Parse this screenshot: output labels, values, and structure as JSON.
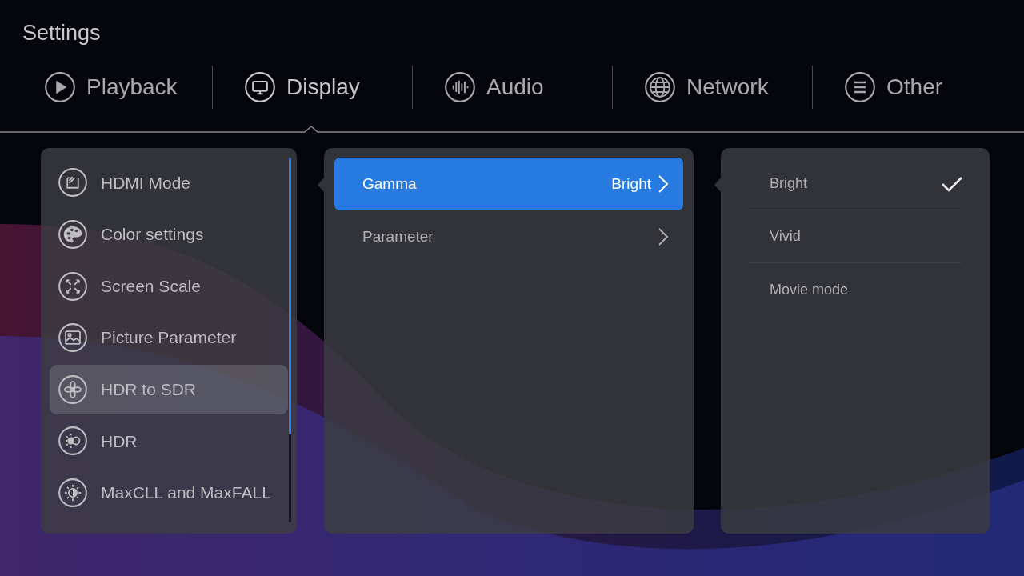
{
  "title": "Settings",
  "tabs": [
    {
      "label": "Playback",
      "selected": false
    },
    {
      "label": "Display",
      "selected": true
    },
    {
      "label": "Audio",
      "selected": false
    },
    {
      "label": "Network",
      "selected": false
    },
    {
      "label": "Other",
      "selected": false
    }
  ],
  "sidebar": {
    "items": [
      {
        "label": "HDMI Mode",
        "selected": false
      },
      {
        "label": "Color settings",
        "selected": false
      },
      {
        "label": "Screen Scale",
        "selected": false
      },
      {
        "label": "Picture Parameter",
        "selected": false
      },
      {
        "label": "HDR to SDR",
        "selected": true
      },
      {
        "label": "HDR",
        "selected": false
      },
      {
        "label": "MaxCLL and MaxFALL",
        "selected": false
      }
    ]
  },
  "settings": [
    {
      "label": "Gamma",
      "value": "Bright",
      "selected": true
    },
    {
      "label": "Parameter",
      "selected": false
    }
  ],
  "options": [
    {
      "label": "Bright",
      "checked": true
    },
    {
      "label": "Vivid",
      "checked": false
    },
    {
      "label": "Movie mode",
      "checked": false
    }
  ]
}
